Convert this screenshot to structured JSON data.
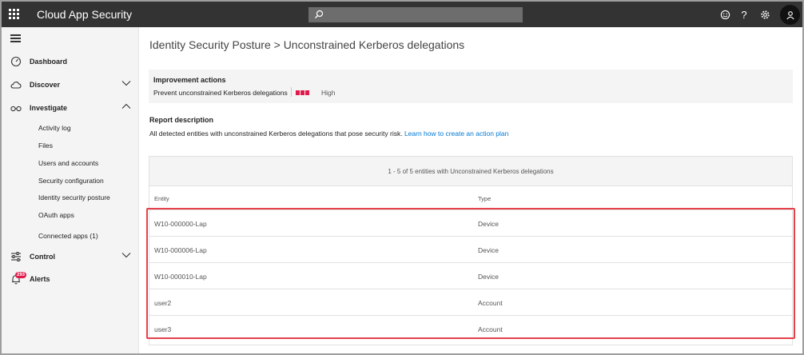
{
  "app": {
    "title": "Cloud App Security"
  },
  "search": {
    "placeholder": ""
  },
  "topbar_icons": [
    "smiley-icon",
    "help-icon",
    "gear-icon",
    "user-icon"
  ],
  "sidebar": {
    "items": [
      {
        "label": "Dashboard",
        "icon": "dashboard-icon"
      },
      {
        "label": "Discover",
        "icon": "cloud-icon",
        "expanded": false
      },
      {
        "label": "Investigate",
        "icon": "glasses-icon",
        "expanded": true
      },
      {
        "label": "Control",
        "icon": "sliders-icon",
        "expanded": false
      },
      {
        "label": "Alerts",
        "icon": "bell-icon",
        "badge": "293"
      }
    ],
    "investigate_sub": [
      "Activity log",
      "Files",
      "Users and accounts",
      "Security configuration",
      "Identity security posture",
      "OAuth apps",
      "Connected apps (1)"
    ]
  },
  "page": {
    "title": "Identity Security Posture > Unconstrained Kerberos delegations"
  },
  "improvement": {
    "heading": "Improvement actions",
    "action": "Prevent unconstrained Kerberos delegations",
    "severity": "High",
    "severity_color": "#e3194b"
  },
  "report": {
    "heading": "Report description",
    "text": "All detected entities with unconstrained Kerberos delegations that pose security risk. ",
    "link": "Learn how to create an action plan"
  },
  "table": {
    "summary": "1 - 5 of 5 entities with Unconstrained Kerberos delegations",
    "columns": [
      "Entity",
      "Type"
    ],
    "rows": [
      [
        "W10-000000-Lap",
        "Device"
      ],
      [
        "W10-000006-Lap",
        "Device"
      ],
      [
        "W10-000010-Lap",
        "Device"
      ],
      [
        "user2",
        "Account"
      ],
      [
        "user3",
        "Account"
      ]
    ]
  },
  "colors": {
    "topbar": "#333333",
    "link": "#0078d4",
    "highlight": "#e5414a"
  }
}
